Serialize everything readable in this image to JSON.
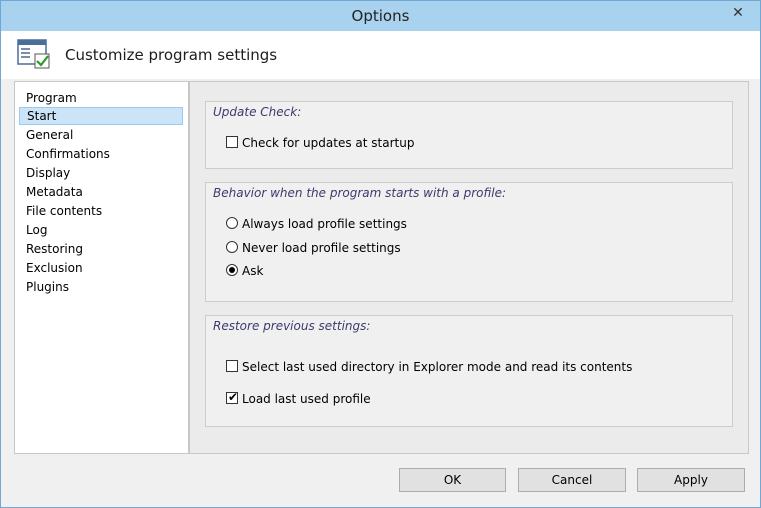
{
  "window": {
    "title": "Options"
  },
  "header": {
    "title": "Customize program settings"
  },
  "sidebar": {
    "items": [
      {
        "label": "Program"
      },
      {
        "label": "Start",
        "selected": true
      },
      {
        "label": "General"
      },
      {
        "label": "Confirmations"
      },
      {
        "label": "Display"
      },
      {
        "label": "Metadata"
      },
      {
        "label": "File contents"
      },
      {
        "label": "Log"
      },
      {
        "label": "Restoring"
      },
      {
        "label": "Exclusion"
      },
      {
        "label": "Plugins"
      }
    ]
  },
  "groups": {
    "update": {
      "title": "Update Check:",
      "check_updates": {
        "label": "Check for updates at startup",
        "checked": false
      }
    },
    "behavior": {
      "title": "Behavior when the program starts with a profile:",
      "options": [
        {
          "label": "Always load profile settings",
          "selected": false
        },
        {
          "label": "Never load profile settings",
          "selected": false
        },
        {
          "label": "Ask",
          "selected": true
        }
      ]
    },
    "restore": {
      "title": "Restore previous settings:",
      "select_last_dir": {
        "label": "Select last used directory in Explorer mode and read its contents",
        "checked": false
      },
      "load_last_profile": {
        "label": "Load last used profile",
        "checked": true
      }
    }
  },
  "buttons": {
    "ok": "OK",
    "cancel": "Cancel",
    "apply": "Apply"
  },
  "icons": {
    "close": "close-icon",
    "header": "settings-window-icon"
  }
}
